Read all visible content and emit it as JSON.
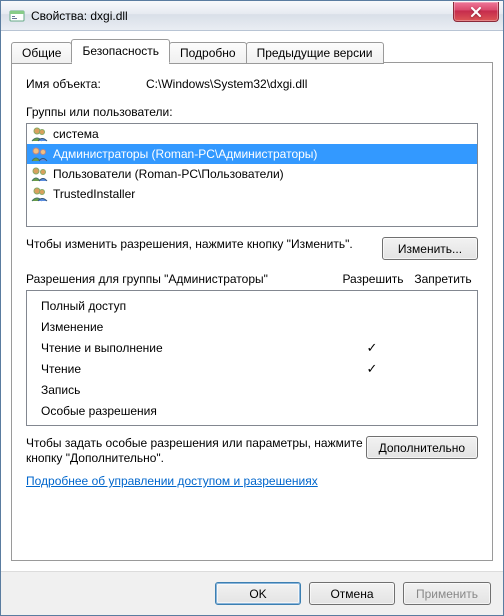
{
  "window": {
    "title": "Свойства: dxgi.dll"
  },
  "tabs": {
    "general": "Общие",
    "security": "Безопасность",
    "details": "Подробно",
    "previous": "Предыдущие версии"
  },
  "object": {
    "label": "Имя объекта:",
    "value": "C:\\Windows\\System32\\dxgi.dll"
  },
  "groups": {
    "label": "Группы или пользователи:",
    "items": [
      {
        "name": "система",
        "icon": "user-single"
      },
      {
        "name": "Администраторы (Roman-PC\\Администраторы)",
        "icon": "user-group",
        "selected": true
      },
      {
        "name": "Пользователи (Roman-PC\\Пользователи)",
        "icon": "user-group"
      },
      {
        "name": "TrustedInstaller",
        "icon": "user-single"
      }
    ]
  },
  "change": {
    "text": "Чтобы изменить разрешения, нажмите кнопку \"Изменить\".",
    "button": "Изменить..."
  },
  "permissions": {
    "lead": "Разрешения для группы \"Администраторы\"",
    "allow": "Разрешить",
    "deny": "Запретить",
    "rows": [
      {
        "name": "Полный доступ",
        "allow": false,
        "deny": false
      },
      {
        "name": "Изменение",
        "allow": false,
        "deny": false
      },
      {
        "name": "Чтение и выполнение",
        "allow": true,
        "deny": false
      },
      {
        "name": "Чтение",
        "allow": true,
        "deny": false
      },
      {
        "name": "Запись",
        "allow": false,
        "deny": false
      },
      {
        "name": "Особые разрешения",
        "allow": false,
        "deny": false
      }
    ]
  },
  "advanced": {
    "text": "Чтобы задать особые разрешения или параметры, нажмите кнопку \"Дополнительно\".",
    "button": "Дополнительно"
  },
  "link": "Подробнее об управлении доступом и разрешениях",
  "footer": {
    "ok": "OK",
    "cancel": "Отмена",
    "apply": "Применить"
  },
  "marks": {
    "check": "✓"
  }
}
